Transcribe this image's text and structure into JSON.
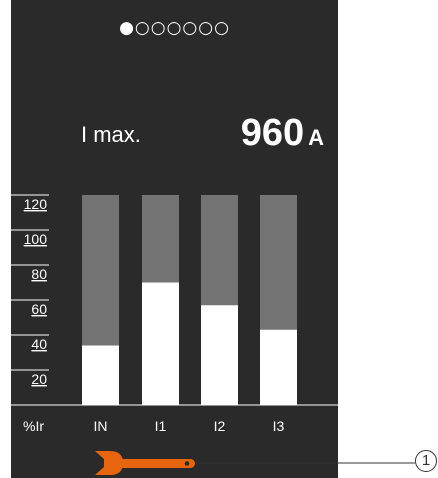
{
  "pager": {
    "dots": "●○○○○○○",
    "active_page": 1,
    "total_pages": 7
  },
  "measurement": {
    "label": "I max.",
    "value": "960",
    "unit": "A"
  },
  "chart_data": {
    "type": "bar",
    "categories": [
      "IN",
      "I1",
      "I2",
      "I3"
    ],
    "values": [
      34,
      70,
      57,
      43
    ],
    "xlabel": "%Ir",
    "yticks": [
      "120",
      "100",
      "80",
      "60",
      "40",
      "20"
    ],
    "ylim": [
      0,
      120
    ],
    "colors": {
      "fill": "#ffffff",
      "track": "#737373",
      "background": "#2a2a2a"
    }
  },
  "toolbar": {
    "wrench_icon": "wrench-icon",
    "wrench_color": "#e8650f"
  },
  "callout": {
    "number": "1"
  }
}
